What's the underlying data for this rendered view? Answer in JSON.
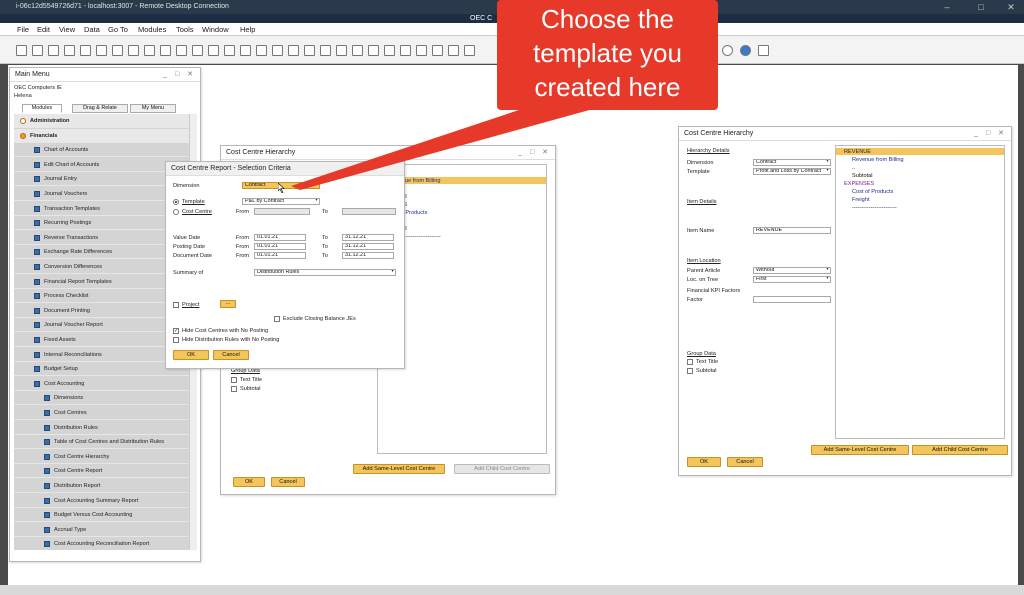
{
  "rdp": {
    "title": "i-06c12d5549726d71 - localhost:3007 - Remote Desktop Connection"
  },
  "app": {
    "title": "OEC C"
  },
  "menu": [
    "File",
    "Edit",
    "View",
    "Data",
    "Go To",
    "Modules",
    "Tools",
    "Window",
    "Help"
  ],
  "callout": {
    "line1": "Choose the",
    "line2": "template you",
    "line3": "created here"
  },
  "main_menu": {
    "title": "Main Menu",
    "company": "OEC Computers IE",
    "user": "Helena",
    "tabs": [
      "Modules",
      "Drag & Relate",
      "My Menu"
    ],
    "items": [
      {
        "label": "Administration",
        "level": 0,
        "bold": true
      },
      {
        "label": "Financials",
        "level": 0,
        "bold": true
      },
      {
        "label": "Chart of Accounts",
        "level": 1
      },
      {
        "label": "Edit Chart of Accounts",
        "level": 1
      },
      {
        "label": "Journal Entry",
        "level": 1
      },
      {
        "label": "Journal Vouchers",
        "level": 1
      },
      {
        "label": "Transaction Templates",
        "level": 1
      },
      {
        "label": "Recurring Postings",
        "level": 1
      },
      {
        "label": "Reverse Transactions",
        "level": 1
      },
      {
        "label": "Exchange Rate Differences",
        "level": 1
      },
      {
        "label": "Conversion Differences",
        "level": 1
      },
      {
        "label": "Financial Report Templates",
        "level": 1
      },
      {
        "label": "Process Checklist",
        "level": 1
      },
      {
        "label": "Document Printing",
        "level": 1
      },
      {
        "label": "Journal Voucher Report",
        "level": 1
      },
      {
        "label": "Fixed Assets",
        "level": 1
      },
      {
        "label": "Internal Reconciliations",
        "level": 1
      },
      {
        "label": "Budget Setup",
        "level": 1
      },
      {
        "label": "Cost Accounting",
        "level": 1
      },
      {
        "label": "Dimensions",
        "level": 2
      },
      {
        "label": "Cost Centres",
        "level": 2
      },
      {
        "label": "Distribution Rules",
        "level": 2
      },
      {
        "label": "Table of Cost Centres and Distribution Rules",
        "level": 2
      },
      {
        "label": "Cost Centre Hierarchy",
        "level": 2
      },
      {
        "label": "Cost Centre Report",
        "level": 2
      },
      {
        "label": "Distribution Report",
        "level": 2
      },
      {
        "label": "Cost Accounting Summary Report",
        "level": 2
      },
      {
        "label": "Budget Versus Cost Accounting",
        "level": 2
      },
      {
        "label": "Accrual Type",
        "level": 2
      },
      {
        "label": "Cost Accounting Reconciliation Report",
        "level": 2
      }
    ]
  },
  "cch_mid": {
    "title": "Cost Centre Hierarchy",
    "tree": [
      "UE",
      "venue from Billing",
      "",
      "total",
      "SES",
      "t of Products",
      "ight",
      "total",
      "------------------------"
    ],
    "group_data": "Group Data",
    "text_title": "Text Title",
    "subtotal": "Subtotal",
    "btn_same": "Add Same-Level Cost Centre",
    "btn_child": "Add Child Cost Centre",
    "ok": "OK",
    "cancel": "Cancel"
  },
  "report_dialog": {
    "title": "Cost Centre Report - Selection Criteria",
    "dimension_label": "Dimension",
    "dimension_value": "Contract",
    "template_label": "Template",
    "template_value": "P&L by Contract",
    "cost_centre_label": "Cost Centre",
    "from": "From",
    "to": "To",
    "value_date_label": "Value Date",
    "posting_date_label": "Posting Date",
    "document_date_label": "Document Date",
    "date_from": "01.01.21",
    "date_to": "31.12.21",
    "summary_label": "Summary of",
    "summary_value": "Distribution Rules",
    "project_label": "Project",
    "exclude_label": "Exclude Closing Balance JEs",
    "hide_cc_label": "Hide Cost Centres with No Posting",
    "hide_dr_label": "Hide Distribution Rules with No Posting",
    "ok": "OK",
    "cancel": "Cancel"
  },
  "cch_right": {
    "title": "Cost Centre Hierarchy",
    "hierarchy_details": "Hierarchy Details",
    "dimension_label": "Dimension",
    "dimension_value": "Contract",
    "template_label": "Template",
    "template_value": "Profit and Loss by Contract",
    "item_details": "Item Details",
    "item_name_label": "Item Name",
    "item_name_value": "REVENUE",
    "item_location": "Item Location",
    "parent_label": "Parent Article",
    "parent_value": "Without",
    "loc_label": "Loc. on Tree",
    "loc_value": "First",
    "kpi_label": "Financial KPI Factors",
    "factor_label": "Factor",
    "group_data": "Group Data",
    "text_title": "Text Title",
    "subtotal": "Subtotal",
    "tree": [
      "REVENUE",
      "Revenue from Billing",
      "..",
      "Subtotal",
      "EXPENSES",
      "Cost of Products",
      "Freight",
      "------------------------"
    ],
    "btn_same": "Add Same-Level Cost Centre",
    "btn_child": "Add Child Cost Centre",
    "ok": "OK",
    "cancel": "Cancel"
  },
  "colors": {
    "callout": "#e6392a",
    "button": "#f4c55c",
    "selected": "#f4c55c",
    "tree_purple": "#7a1f8a",
    "tree_blue": "#1f2e8a"
  }
}
